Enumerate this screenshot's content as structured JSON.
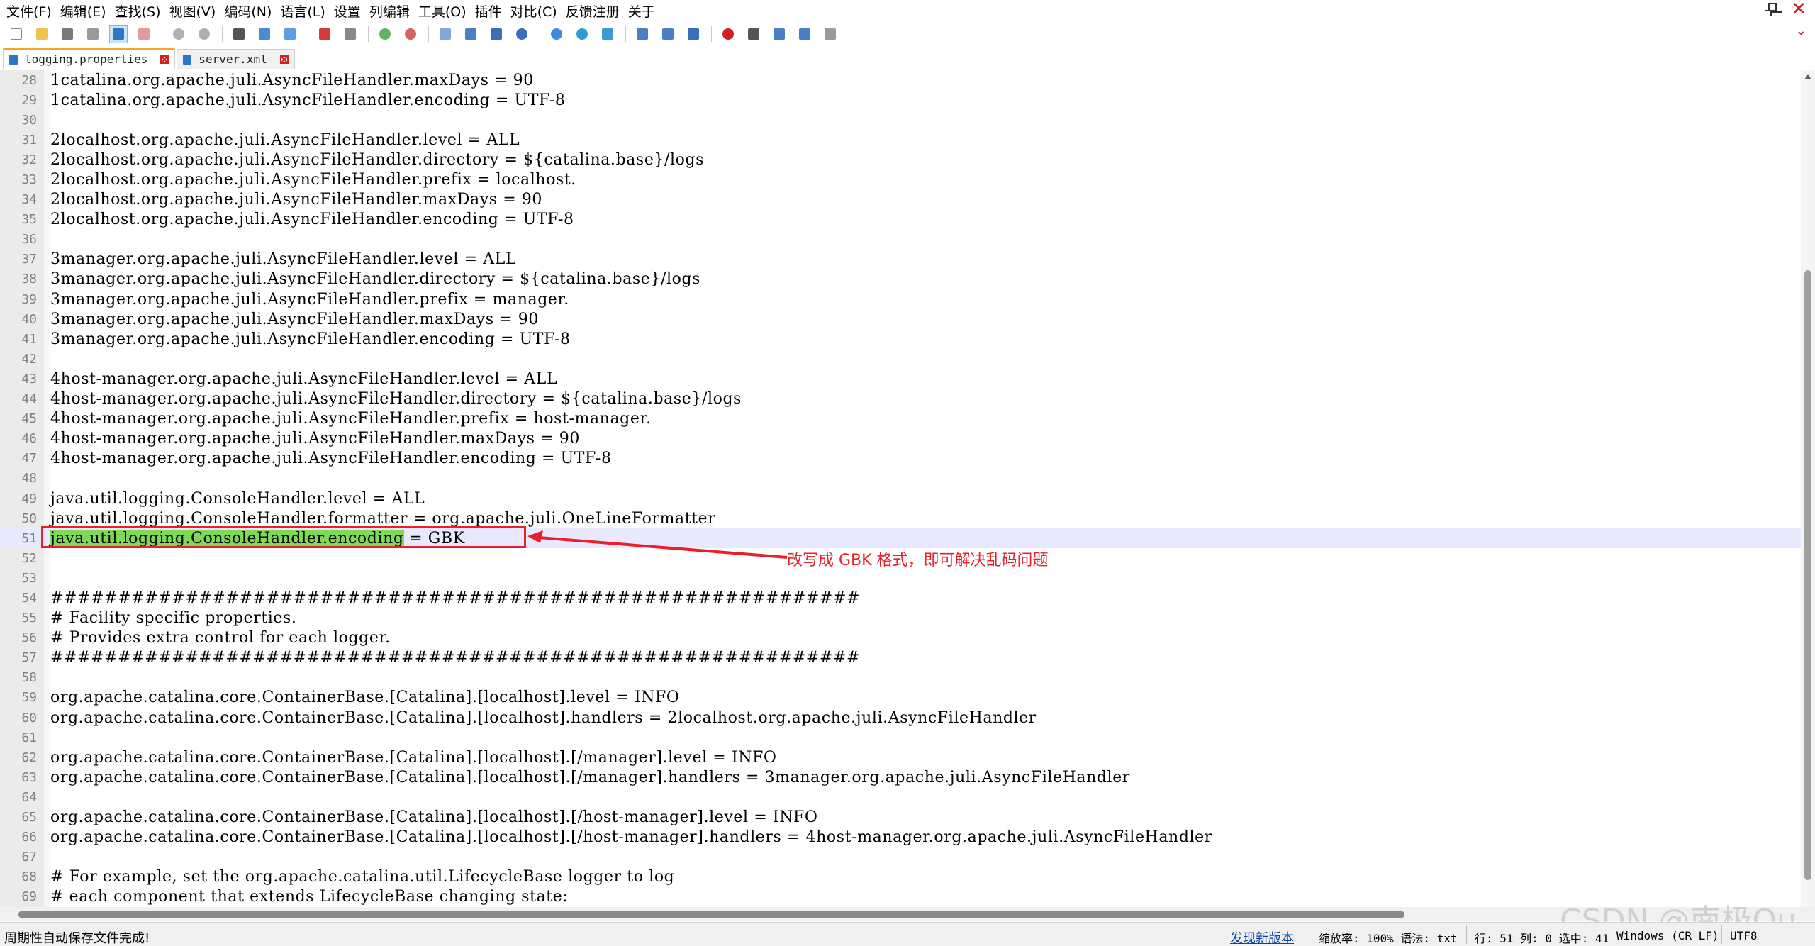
{
  "menu": [
    "文件(F)",
    "编辑(E)",
    "查找(S)",
    "视图(V)",
    "编码(N)",
    "语言(L)",
    "设置",
    "列编辑",
    "工具(O)",
    "插件",
    "对比(C)",
    "反馈注册",
    "关于"
  ],
  "tabs": [
    {
      "label": "logging.properties",
      "active": true
    },
    {
      "label": "server.xml",
      "active": false
    }
  ],
  "editor": {
    "lines": [
      {
        "n": "28",
        "text": "1catalina.org.apache.juli.AsyncFileHandler.maxDays = 90"
      },
      {
        "n": "29",
        "text": "1catalina.org.apache.juli.AsyncFileHandler.encoding = UTF-8"
      },
      {
        "n": "30",
        "text": ""
      },
      {
        "n": "31",
        "text": "2localhost.org.apache.juli.AsyncFileHandler.level = ALL"
      },
      {
        "n": "32",
        "text": "2localhost.org.apache.juli.AsyncFileHandler.directory = ${catalina.base}/logs"
      },
      {
        "n": "33",
        "text": "2localhost.org.apache.juli.AsyncFileHandler.prefix = localhost."
      },
      {
        "n": "34",
        "text": "2localhost.org.apache.juli.AsyncFileHandler.maxDays = 90"
      },
      {
        "n": "35",
        "text": "2localhost.org.apache.juli.AsyncFileHandler.encoding = UTF-8"
      },
      {
        "n": "36",
        "text": ""
      },
      {
        "n": "37",
        "text": "3manager.org.apache.juli.AsyncFileHandler.level = ALL"
      },
      {
        "n": "38",
        "text": "3manager.org.apache.juli.AsyncFileHandler.directory = ${catalina.base}/logs"
      },
      {
        "n": "39",
        "text": "3manager.org.apache.juli.AsyncFileHandler.prefix = manager."
      },
      {
        "n": "40",
        "text": "3manager.org.apache.juli.AsyncFileHandler.maxDays = 90"
      },
      {
        "n": "41",
        "text": "3manager.org.apache.juli.AsyncFileHandler.encoding = UTF-8"
      },
      {
        "n": "42",
        "text": ""
      },
      {
        "n": "43",
        "text": "4host-manager.org.apache.juli.AsyncFileHandler.level = ALL"
      },
      {
        "n": "44",
        "text": "4host-manager.org.apache.juli.AsyncFileHandler.directory = ${catalina.base}/logs"
      },
      {
        "n": "45",
        "text": "4host-manager.org.apache.juli.AsyncFileHandler.prefix = host-manager."
      },
      {
        "n": "46",
        "text": "4host-manager.org.apache.juli.AsyncFileHandler.maxDays = 90"
      },
      {
        "n": "47",
        "text": "4host-manager.org.apache.juli.AsyncFileHandler.encoding = UTF-8"
      },
      {
        "n": "48",
        "text": ""
      },
      {
        "n": "49",
        "text": "java.util.logging.ConsoleHandler.level = ALL"
      },
      {
        "n": "50",
        "text": "java.util.logging.ConsoleHandler.formatter = org.apache.juli.OneLineFormatter"
      },
      {
        "n": "51",
        "text": "",
        "selected": "java.util.logging.ConsoleHandler.encoding",
        "rest": " = GBK"
      },
      {
        "n": "52",
        "text": ""
      },
      {
        "n": "53",
        "text": ""
      },
      {
        "n": "54",
        "text": "############################################################"
      },
      {
        "n": "55",
        "text": "# Facility specific properties."
      },
      {
        "n": "56",
        "text": "# Provides extra control for each logger."
      },
      {
        "n": "57",
        "text": "############################################################"
      },
      {
        "n": "58",
        "text": ""
      },
      {
        "n": "59",
        "text": "org.apache.catalina.core.ContainerBase.[Catalina].[localhost].level = INFO"
      },
      {
        "n": "60",
        "text": "org.apache.catalina.core.ContainerBase.[Catalina].[localhost].handlers = 2localhost.org.apache.juli.AsyncFileHandler"
      },
      {
        "n": "61",
        "text": ""
      },
      {
        "n": "62",
        "text": "org.apache.catalina.core.ContainerBase.[Catalina].[localhost].[/manager].level = INFO"
      },
      {
        "n": "63",
        "text": "org.apache.catalina.core.ContainerBase.[Catalina].[localhost].[/manager].handlers = 3manager.org.apache.juli.AsyncFileHandler"
      },
      {
        "n": "64",
        "text": ""
      },
      {
        "n": "65",
        "text": "org.apache.catalina.core.ContainerBase.[Catalina].[localhost].[/host-manager].level = INFO"
      },
      {
        "n": "66",
        "text": "org.apache.catalina.core.ContainerBase.[Catalina].[localhost].[/host-manager].handlers = 4host-manager.org.apache.juli.AsyncFileHandler"
      },
      {
        "n": "67",
        "text": ""
      },
      {
        "n": "68",
        "text": "# For example, set the org.apache.catalina.util.LifecycleBase logger to log"
      },
      {
        "n": "69",
        "text": "# each component that extends LifecycleBase changing state:"
      }
    ],
    "current_line": "51"
  },
  "annotation": {
    "text": "改写成 GBK 格式，即可解决乱码问题",
    "color": "#e8202a"
  },
  "statusbar": {
    "message": "周期性自动保存文件完成!",
    "link": "发现新版本",
    "zoom": "缩放率: 100% 语法: txt",
    "position": "行: 51  列: 0  选中: 41",
    "eol": "Windows (CR LF)",
    "encoding": "UTF8"
  },
  "watermark": "CSDN @南极Ou",
  "colors": {
    "selection": "#7ed957",
    "current_line": "#e8e8ff",
    "accent_tab": "#f5a623"
  }
}
